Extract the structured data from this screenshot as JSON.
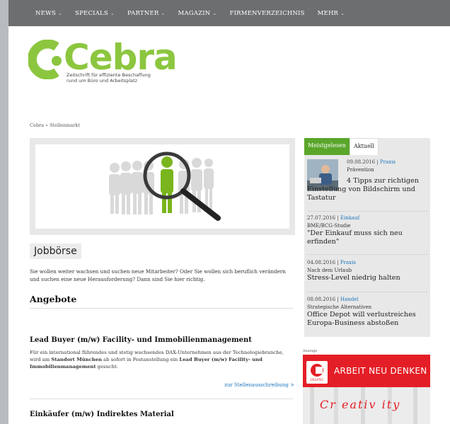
{
  "nav": {
    "items": [
      {
        "label": "NEWS",
        "chevron": true
      },
      {
        "label": "SPECIALS",
        "chevron": true
      },
      {
        "label": "PARTNER",
        "chevron": true
      },
      {
        "label": "MAGAZIN",
        "chevron": true
      },
      {
        "label": "FIRMENVERZEICHNIS",
        "chevron": false
      },
      {
        "label": "MEHR",
        "chevron": true
      }
    ]
  },
  "logo": {
    "wordmark": "Cebra",
    "tagline_line1": "Zeitschrift für effiziente Beschaffung",
    "tagline_line2": "rund um Büro und Arbeitsplatz",
    "color": "#8cc63f"
  },
  "breadcrumb": "Cebra » Stellenmarkt",
  "main": {
    "section_title": "Jobbörse",
    "intro": "Sie wollen weiter wachsen und suchen neue Mitarbeiter? Oder Sie wollen sich beruflich verändern und suchen eine neue Herausforderung? Dann sind Sie hier richtig.",
    "offers_heading": "Angebote",
    "jobs": [
      {
        "title": "Lead Buyer (m/w) Facility- und Immobilienmanagement",
        "desc_1": "Für ein international führendes und stetig wachsendes DAX-Unternehmen aus der Technologiebranche, wird am ",
        "desc_bold_1": "Standort München",
        "desc_2": " ab sofort in Festanstellung ein ",
        "desc_bold_2": "Lead Buyer (m/w) Facility- und Immobilienmanagement",
        "desc_3": " gesucht.",
        "link": "zur Stellenausschreibung >"
      },
      {
        "title": "Einkäufer (m/w) Indirektes Material"
      }
    ]
  },
  "sidebar": {
    "tabs": [
      {
        "label": "Meistgelesen",
        "active": true
      },
      {
        "label": "Aktuell",
        "active": false
      }
    ],
    "items": [
      {
        "date": "09.08.2016",
        "category": "Praxis",
        "kicker": "Prävention",
        "headline": "4 Tipps zur richtigen Einstellung von Bildschirm und Tastatur"
      },
      {
        "date": "27.07.2016",
        "category": "Einkauf",
        "kicker": "BME/BCG-Studie",
        "headline": "\"Der Einkauf muss sich neu erfinden\""
      },
      {
        "date": "04.08.2016",
        "category": "Praxis",
        "kicker": "Nach dem Urlaub",
        "headline": "Stress-Level niedrig halten"
      },
      {
        "date": "08.08.2016",
        "category": "Handel",
        "kicker": "Strategische Alternativen",
        "headline": "Office Depot will verlustreiches Europa-Business abstoßen"
      }
    ]
  },
  "ad": {
    "label": "Anzeige",
    "brand": "ORGATEC",
    "headline": "ARBEIT NEU DENKEN",
    "script": "Cr eativ ity"
  },
  "colors": {
    "accent_green": "#5aa62b",
    "link_blue": "#1b75bb",
    "nav_bg": "#6d6e70",
    "ad_red": "#e41e26"
  }
}
